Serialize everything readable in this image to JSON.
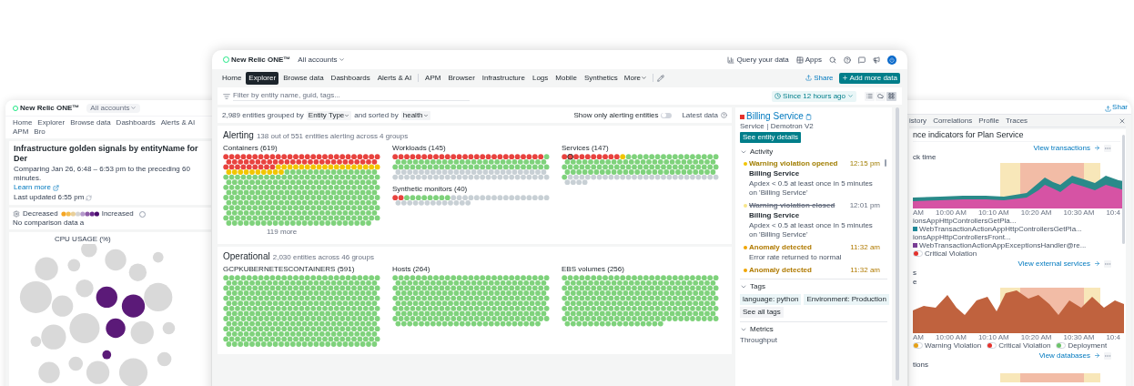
{
  "left_window": {
    "logo": "New Relic ONE™",
    "account": "All accounts",
    "nav": [
      "Home",
      "Explorer",
      "Browse data",
      "Dashboards",
      "Alerts & AI",
      "APM",
      "Bro"
    ],
    "title": "Infrastructure golden signals by entityName for Der",
    "subtitle": "Comparing Jan 26, 6:48 – 6:53 pm to the preceding 60 minutes.",
    "learn_more": "Learn more",
    "updated": "Last updated 6:55 pm",
    "legend": {
      "decreased": "Decreased",
      "increased": "Increased",
      "none": "No comparison data a"
    },
    "chart_title": "CPU USAGE (%)"
  },
  "right_window": {
    "share": "Shar",
    "tabs": [
      {
        "label": "istory",
        "selected": false
      },
      {
        "label": "Correlations",
        "selected": false
      },
      {
        "label": "Profile",
        "selected": false
      },
      {
        "label": "Traces",
        "selected": false
      }
    ],
    "title": "nce indicators for Plan Service",
    "panels": [
      {
        "kind": "stacked",
        "link": "View transactions",
        "labels": [
          "ck time"
        ],
        "axis": [
          "AM",
          "10:00 AM",
          "10:10 AM",
          "10:20 AM",
          "10:30 AM",
          "10:4"
        ],
        "legend": [
          {
            "label": "ionsAppHttpControllersGetPla..."
          },
          {
            "label": "WebTransactionActionAppHttpControllersGetPla...",
            "color": "#1f8a9a"
          },
          {
            "label": "ionsAppHttpControllersFront...",
            "kind": "plain"
          },
          {
            "label": "WebTransactionActionAppExceptionsHandler@re...",
            "color": "#7b3f98"
          },
          {
            "label": "Critical Violation",
            "color": "#e5322d",
            "kind": "toggle"
          }
        ]
      },
      {
        "kind": "single",
        "link": "View external services",
        "labels": [
          "s",
          "e"
        ],
        "axis": [
          "AM",
          "10:00 AM",
          "10:10 AM",
          "10:20 AM",
          "10:30 AM",
          "10:4"
        ],
        "legend": [
          {
            "label": "Warning Violation",
            "color": "#e8a317",
            "kind": "toggle"
          },
          {
            "label": "Critical Violation",
            "color": "#e5322d",
            "kind": "toggle"
          },
          {
            "label": "Deployment",
            "color": "#6cc26a",
            "kind": "toggle"
          }
        ]
      },
      {
        "kind": "bands",
        "link": "View databases",
        "labels": [
          "tions"
        ]
      }
    ]
  },
  "main_window": {
    "header": {
      "logo": "New Relic ONE™",
      "account": "All accounts",
      "query": "Query your data",
      "apps": "Apps"
    },
    "nav": {
      "groups": [
        [
          {
            "label": "Home",
            "selected": false
          },
          {
            "label": "Explorer",
            "selected": true
          },
          {
            "label": "Browse data",
            "selected": false
          },
          {
            "label": "Dashboards",
            "selected": false
          },
          {
            "label": "Alerts & AI",
            "selected": false
          }
        ],
        [
          {
            "label": "APM",
            "selected": false
          },
          {
            "label": "Browser",
            "selected": false
          },
          {
            "label": "Infrastructure",
            "selected": false
          },
          {
            "label": "Logs",
            "selected": false
          },
          {
            "label": "Mobile",
            "selected": false
          },
          {
            "label": "Synthetics",
            "selected": false
          }
        ]
      ],
      "more": "More",
      "share": "Share",
      "add": "Add more data"
    },
    "filter": {
      "placeholder": "Filter by entity name, guid, tags...",
      "time": "Since 12 hours ago",
      "views": [
        {
          "kind": "list",
          "selected": false
        },
        {
          "kind": "cloud",
          "selected": false
        },
        {
          "kind": "grid",
          "selected": true
        }
      ]
    },
    "toolbar": {
      "count": "2,989 entities grouped by",
      "group_by": "Entity Type",
      "sorted": "and sorted by",
      "sort": "health",
      "toggle_label": "Show only alerting entities",
      "toggle_on": false,
      "latest": "Latest data"
    },
    "sections": [
      {
        "title": "Alerting",
        "summary": "138 out of 551 entities alerting across 4 groups",
        "columns": [
          [
            {
              "title": "Containers (619)",
              "more": "119 more"
            }
          ],
          [
            {
              "title": "Workloads (145)"
            },
            {
              "title": "Synthetic monitors (40)"
            }
          ],
          [
            {
              "title": "Services (147)"
            }
          ]
        ]
      },
      {
        "title": "Operational",
        "summary": "2,030 entities across 46 groups",
        "columns": [
          [
            {
              "title": "GCPKUBERNETESCONTAINERS (591)"
            }
          ],
          [
            {
              "title": "Hosts (264)"
            }
          ],
          [
            {
              "title": "EBS volumes (256)"
            }
          ]
        ]
      }
    ],
    "panel": {
      "color": "#e5322d",
      "title": "Billing Service",
      "type": "Service",
      "account": "Demotron V2",
      "details": "See entity details",
      "activity": {
        "title": "Activity",
        "expanded": true,
        "items": [
          {
            "kind": "warning_opened",
            "title": "Warning violation opened",
            "time": "12:15 pm",
            "entity": "Billing Service",
            "text": "Apdex < 0.5 at least once in 5 minutes on 'Billing Service'"
          },
          {
            "kind": "warning_closed",
            "title": "Warning violation closed",
            "time": "12:01 pm",
            "entity": "Billing Service",
            "text": "Apdex < 0.5 at least once in 5 minutes on 'Billing Service'"
          },
          {
            "kind": "anomaly",
            "title": "Anomaly detected",
            "time": "11:32 am",
            "text": "Error rate returned to normal"
          },
          {
            "kind": "anomaly",
            "title": "Anomaly detected",
            "time": "11:32 am"
          }
        ]
      },
      "tags": {
        "title": "Tags",
        "expanded": true,
        "items": [
          "language: python",
          "Environment: Production"
        ],
        "all": "See all tags"
      },
      "metrics": {
        "title": "Metrics",
        "expanded": true,
        "label": "Throughput"
      }
    }
  }
}
